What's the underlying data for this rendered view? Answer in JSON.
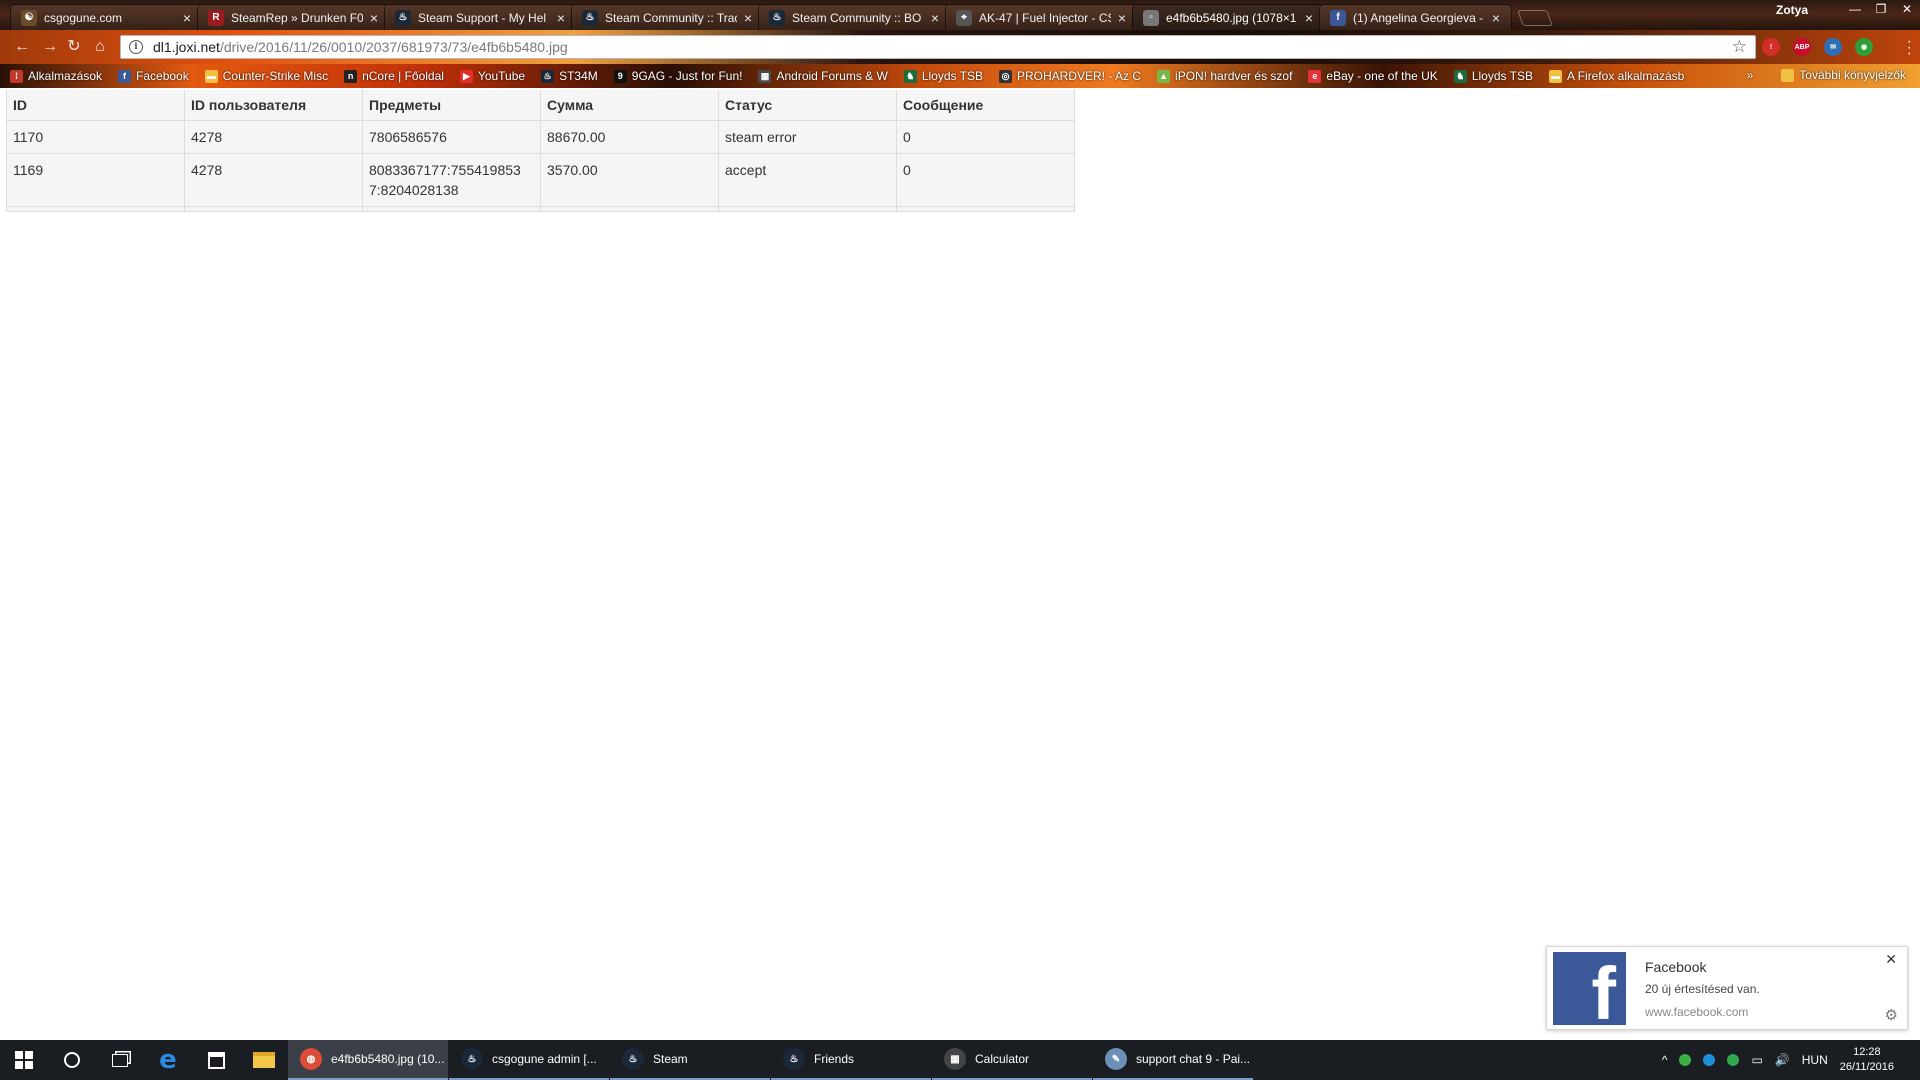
{
  "browser": {
    "tabs": [
      {
        "title": "csgogune.com",
        "favicon_color": "#6b4c2a",
        "favicon_glyph": "☯",
        "active": false
      },
      {
        "title": "SteamRep » Drunken F0",
        "favicon_color": "#9b1c1c",
        "favicon_glyph": "R",
        "active": false
      },
      {
        "title": "Steam Support - My Hel",
        "favicon_color": "#1b2838",
        "favicon_glyph": "♨",
        "active": false
      },
      {
        "title": "Steam Community :: Trad",
        "favicon_color": "#1b2838",
        "favicon_glyph": "♨",
        "active": false
      },
      {
        "title": "Steam Community :: BO",
        "favicon_color": "#1b2838",
        "favicon_glyph": "♨",
        "active": false
      },
      {
        "title": "AK-47 | Fuel Injector - CS",
        "favicon_color": "#555555",
        "favicon_glyph": "⌖",
        "active": false
      },
      {
        "title": "e4fb6b5480.jpg (1078×1",
        "favicon_color": "#777777",
        "favicon_glyph": "▫",
        "active": true
      },
      {
        "title": "(1) Angelina Georgieva -",
        "favicon_color": "#3b5998",
        "favicon_glyph": "f",
        "active": false
      }
    ],
    "profile_name": "Zotya",
    "window_controls": {
      "minimize": "—",
      "restore": "❐",
      "close": "✕"
    },
    "address": {
      "host": "dl1.joxi.net",
      "path": "/drive/2016/11/26/0010/2037/681973/73/e4fb6b5480.jpg"
    },
    "nav": {
      "back": "←",
      "forward": "→",
      "reload": "↻",
      "home": "⌂"
    },
    "extensions": [
      {
        "name": "lastpass-icon",
        "color": "#d32d27",
        "glyph": "!"
      },
      {
        "name": "adblock-plus-icon",
        "color": "#c70d2c",
        "glyph": "ABP"
      },
      {
        "name": "mail-icon",
        "color": "#2d6fb6",
        "glyph": "✉"
      },
      {
        "name": "vpn-icon",
        "color": "#2f9e3a",
        "glyph": "◉"
      }
    ],
    "bookmarks": [
      {
        "label": "Alkalmazások",
        "icon_color": "#c0392b",
        "glyph": "⁞"
      },
      {
        "label": "Facebook",
        "icon_color": "#3b5998",
        "glyph": "f"
      },
      {
        "label": "Counter-Strike Misc",
        "icon_color": "#f0c040",
        "glyph": "▬"
      },
      {
        "label": "nCore | Főoldal",
        "icon_color": "#222222",
        "glyph": "n"
      },
      {
        "label": "YouTube",
        "icon_color": "#e52d27",
        "glyph": "▶"
      },
      {
        "label": "ST34M",
        "icon_color": "#1b2838",
        "glyph": "♨"
      },
      {
        "label": "9GAG - Just for Fun!",
        "icon_color": "#111111",
        "glyph": "9"
      },
      {
        "label": "Android Forums & W",
        "icon_color": "#4a4a4a",
        "glyph": "▦"
      },
      {
        "label": "Lloyds TSB",
        "icon_color": "#1c6b3a",
        "glyph": "♞"
      },
      {
        "label": "PROHARDVER! - Az C",
        "icon_color": "#333333",
        "glyph": "◎"
      },
      {
        "label": "iPON! hardver és szof",
        "icon_color": "#7ab648",
        "glyph": "▲"
      },
      {
        "label": "eBay - one of the UK",
        "icon_color": "#e53238",
        "glyph": "e"
      },
      {
        "label": "Lloyds TSB",
        "icon_color": "#1c6b3a",
        "glyph": "♞"
      },
      {
        "label": "A Firefox alkalmazásb",
        "icon_color": "#f0c040",
        "glyph": "▬"
      }
    ],
    "bookmarks_more": {
      "label": "További könyvjelzők",
      "chevron": "»"
    }
  },
  "orders_table": {
    "headers": [
      "ID",
      "ID пользователя",
      "Предметы",
      "Сумма",
      "Статус",
      "Сообщение"
    ],
    "rows": [
      [
        "1170",
        "4278",
        "7806586576",
        "88670.00",
        "steam error",
        "0"
      ],
      [
        "1169",
        "4278",
        "8083367177:755419853\n7:8204028138",
        "3570.00",
        "accept",
        "0"
      ]
    ]
  },
  "notification": {
    "title": "Facebook",
    "body": "20 új értesítésed van.",
    "site": "www.facebook.com",
    "logo_glyph": "f",
    "close": "✕",
    "settings": "⚙"
  },
  "taskbar": {
    "tasks": [
      {
        "label": "e4fb6b5480.jpg (10...",
        "icon_color": "#dd4b39",
        "glyph": "◍",
        "active": true
      },
      {
        "label": "csgogune admin [...",
        "icon_color": "#1b2838",
        "glyph": "♨",
        "active": false
      },
      {
        "label": "Steam",
        "icon_color": "#1b2838",
        "glyph": "♨",
        "active": false
      },
      {
        "label": "Friends",
        "icon_color": "#1b2838",
        "glyph": "♨",
        "active": false
      },
      {
        "label": "Calculator",
        "icon_color": "#444444",
        "glyph": "▦",
        "active": false
      },
      {
        "label": "support chat 9 - Pai...",
        "icon_color": "#6b8fb5",
        "glyph": "✎",
        "active": false
      }
    ],
    "tray": {
      "chevron": "^",
      "language": "HUN",
      "volume": "🔊",
      "time": "12:28",
      "date": "26/11/2016"
    }
  }
}
